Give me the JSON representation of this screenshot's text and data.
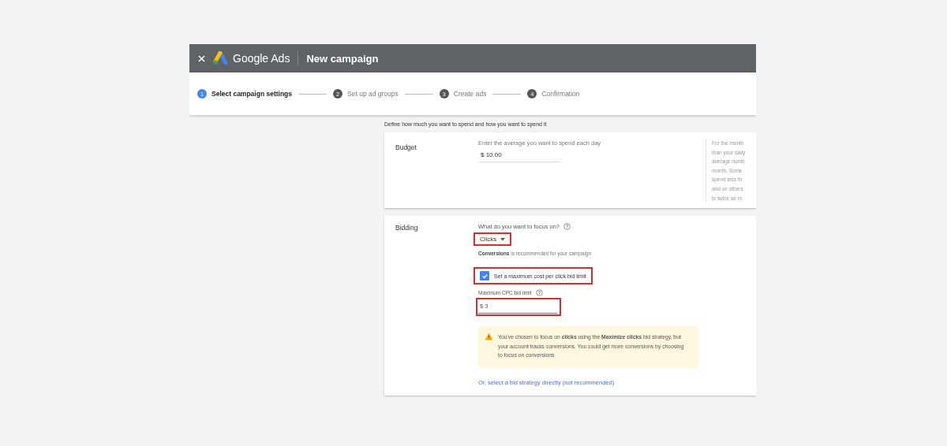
{
  "header": {
    "product": "Google Ads",
    "title": "New campaign"
  },
  "steps": [
    {
      "number": "1",
      "label": "Select campaign settings",
      "selected": true
    },
    {
      "number": "2",
      "label": "Set up ad groups",
      "selected": false
    },
    {
      "number": "3",
      "label": "Create ads",
      "selected": false
    },
    {
      "number": "4",
      "label": "Confirmation",
      "selected": false
    }
  ],
  "section_description": "Define how much you want to spend and how you want to spend it",
  "budget": {
    "label": "Budget",
    "prompt": "Enter the average you want to spend each day",
    "value": "$ 10.00",
    "help_lines": [
      "For the month",
      "than your daily",
      "average numb",
      "month. Some",
      "spend less th",
      "and on others",
      "to twice as m"
    ]
  },
  "bidding": {
    "label": "Bidding",
    "focus_question": "What do you want to focus on?",
    "focus_value": "Clicks",
    "recommendation": "**Conversions** is recommended for your campaign",
    "max_cpc_checkbox": {
      "label": "Set a maximum cost per click bid limit",
      "checked": true
    },
    "max_cpc_label": "Maximum CPC bid limit",
    "max_cpc_value": "$ 3",
    "warning": "You've chosen to focus on **clicks** using the **Maximize clicks** bid strategy, but your account tracks conversions. You could get more conversions by choosing to focus on conversions",
    "strategy_link": "Or, select a bid strategy directly (not recommended)"
  }
}
